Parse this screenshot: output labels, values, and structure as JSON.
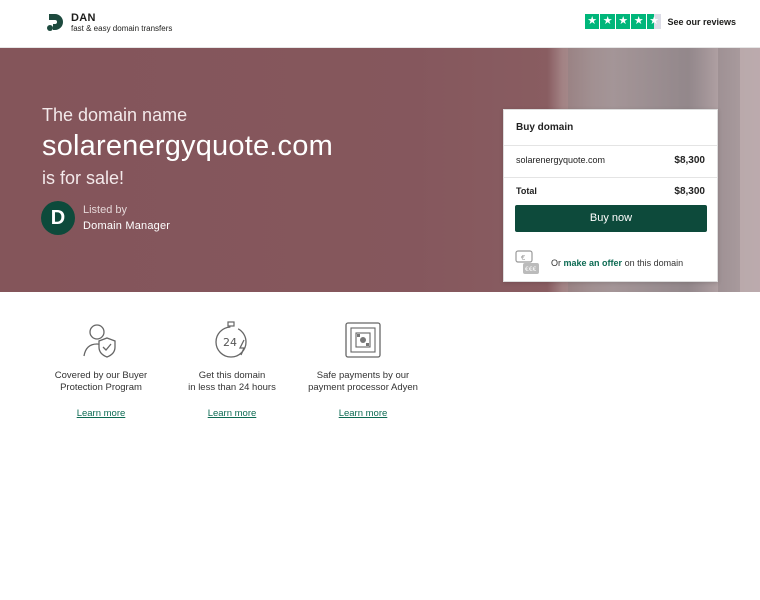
{
  "header": {
    "logo_name": "DAN",
    "logo_tagline": "fast & easy domain transfers",
    "reviews_label": "See our reviews",
    "star_color": "#00b67a"
  },
  "hero": {
    "intro": "The domain name",
    "domain": "solarenergyquote.com",
    "for_sale": "is for sale!",
    "seller_initial": "D",
    "seller_label": "Listed by",
    "seller_name": "Domain Manager"
  },
  "card": {
    "title": "Buy domain",
    "item_name": "solarenergyquote.com",
    "item_price": "$8,300",
    "total_label": "Total",
    "total_price": "$8,300",
    "buy_label": "Buy now",
    "offer_prefix": "Or",
    "offer_link": "make an offer",
    "offer_suffix": "on this domain",
    "accent": "#0d4a3b"
  },
  "features": [
    {
      "line1": "Covered by our Buyer",
      "line2": "Protection Program",
      "link": "Learn more",
      "icon": "buyer-protection-icon"
    },
    {
      "line1": "Get this domain",
      "line2": "in less than 24 hours",
      "link": "Learn more",
      "icon": "24-hours-icon"
    },
    {
      "line1": "Safe payments by our",
      "line2": "payment processor Adyen",
      "link": "Learn more",
      "icon": "safe-payment-icon"
    }
  ]
}
